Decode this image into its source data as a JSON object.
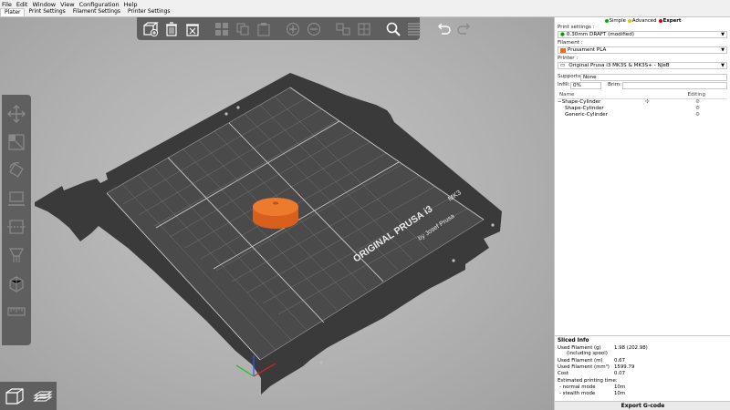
{
  "menu": [
    "File",
    "Edit",
    "Window",
    "View",
    "Configuration",
    "Help"
  ],
  "tabs": [
    {
      "label": "Plater",
      "active": true
    },
    {
      "label": "Print Settings",
      "active": false
    },
    {
      "label": "Filament Settings",
      "active": false
    },
    {
      "label": "Printer Settings",
      "active": false
    }
  ],
  "toolbar_icons": [
    "add-icon",
    "delete-icon",
    "delete-all-icon",
    "arrange-icon",
    "copy-icon",
    "paste-icon",
    "add-instance-icon",
    "remove-instance-icon",
    "split-objects-icon",
    "split-parts-icon",
    "search-icon",
    "layers-editing-icon",
    "undo-icon",
    "redo-icon"
  ],
  "left_toolbar_icons": [
    "move-icon",
    "scale-icon",
    "rotate-icon",
    "place-on-face-icon",
    "cut-icon",
    "support-paint-icon",
    "seam-paint-icon",
    "measure-icon"
  ],
  "bed": {
    "brand_line1": "ORIGINAL PRUSA i3",
    "brand_model": "MK3",
    "brand_line2": "by Josef Prusa"
  },
  "colors": {
    "accent": "#ed6b21",
    "simple": "#00b000",
    "advanced": "#e8c400",
    "expert": "#d00000",
    "toolbar": "#5f5f5f",
    "bed": "#3a3a3a"
  },
  "modes": {
    "simple": "Simple",
    "advanced": "Advanced",
    "expert": "Expert"
  },
  "print_settings": {
    "label": "Print settings :",
    "value": "0.30mm DRAFT (modified)"
  },
  "filament": {
    "label": "Filament :",
    "value": "Prusament PLA",
    "color": "#ed6b21"
  },
  "printer": {
    "label": "Printer :",
    "value": "Original Prusa i3 MK3S & MK3S+ - NJeB"
  },
  "supports": {
    "label": "Supports:",
    "value": "None"
  },
  "infill": {
    "label": "Infill:",
    "value": "0%"
  },
  "brim": {
    "label": "Brim:"
  },
  "object_list": {
    "col_name": "Name",
    "col_editing": "Editing",
    "rows": [
      {
        "name": "Shape-Cylinder",
        "indent": 0,
        "prefix": "−"
      },
      {
        "name": "Shape-Cylinder",
        "indent": 1,
        "prefix": ""
      },
      {
        "name": "Generic-Cylinder",
        "indent": 1,
        "prefix": ""
      }
    ]
  },
  "sliced_info": {
    "title": "Sliced Info",
    "rows": [
      {
        "key": "Used Filament (g)",
        "value": "1.98 (202.98)"
      },
      {
        "key": "(including spool)",
        "value": ""
      },
      {
        "key": "Used Filament (m)",
        "value": "0.67"
      },
      {
        "key": "Used Filament (mm³)",
        "value": "1599.79"
      },
      {
        "key": "Cost",
        "value": "0.07"
      },
      {
        "key": "Estimated printing time:",
        "value": ""
      },
      {
        "key": "- normal mode",
        "value": "10m"
      },
      {
        "key": "- stealth mode",
        "value": "10m"
      }
    ]
  },
  "export_label": "Export G-code"
}
